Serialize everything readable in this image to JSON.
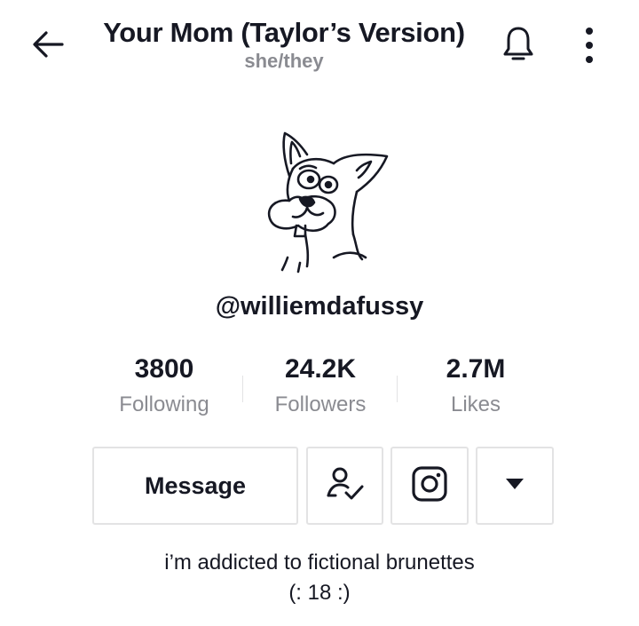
{
  "header": {
    "title": "Your Mom (Taylor’s Version)",
    "pronouns": "she/they",
    "icons": {
      "back": "back-arrow-icon",
      "notifications": "bell-icon",
      "more": "more-vertical-icon"
    }
  },
  "profile": {
    "avatar_icon": "cartoon-cat-avatar",
    "username": "@williemdafussy"
  },
  "stats": [
    {
      "value": "3800",
      "label": "Following"
    },
    {
      "value": "24.2K",
      "label": "Followers"
    },
    {
      "value": "2.7M",
      "label": "Likes"
    }
  ],
  "actions": {
    "message_label": "Message",
    "friend_icon": "user-check-icon",
    "instagram_icon": "instagram-icon",
    "more_icon": "caret-down-icon"
  },
  "bio": {
    "line1": "i’m addicted to fictional brunettes",
    "line2": "(: 18 :)"
  },
  "colors": {
    "text_primary": "#161823",
    "text_secondary": "#8a8b91",
    "border": "#e3e3e4",
    "background": "#ffffff"
  }
}
